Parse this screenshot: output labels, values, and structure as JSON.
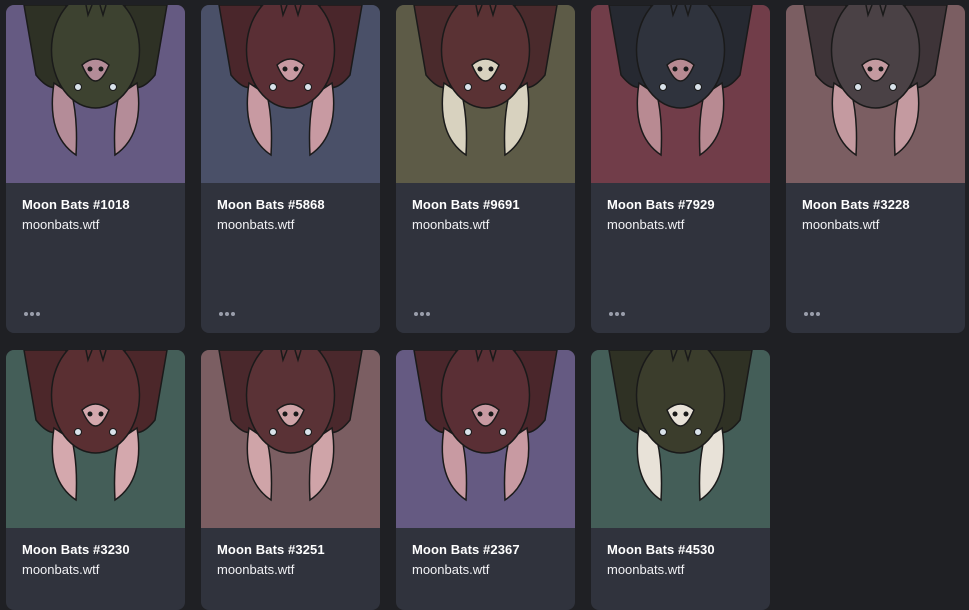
{
  "cards": [
    {
      "name": "Moon Bats #1018",
      "collection": "moonbats.wtf",
      "bg": "#655a82",
      "bat": "#3d4230",
      "wing": "#2e3125",
      "accent": "#b48c98",
      "icon": "bat-nft-image",
      "show_more": true
    },
    {
      "name": "Moon Bats #5868",
      "collection": "moonbats.wtf",
      "bg": "#4a5068",
      "bat": "#5a2f35",
      "wing": "#4a262b",
      "accent": "#c89aa2",
      "icon": "bat-nft-image",
      "show_more": true
    },
    {
      "name": "Moon Bats #9691",
      "collection": "moonbats.wtf",
      "bg": "#5d5b47",
      "bat": "#5a3234",
      "wing": "#4a2a2c",
      "accent": "#d8d2bf",
      "icon": "bat-nft-image",
      "show_more": true
    },
    {
      "name": "Moon Bats #7929",
      "collection": "moonbats.wtf",
      "bg": "#713d49",
      "bat": "#2f333d",
      "wing": "#262931",
      "accent": "#b88a92",
      "icon": "bat-nft-image",
      "show_more": true
    },
    {
      "name": "Moon Bats #3228",
      "collection": "moonbats.wtf",
      "bg": "#7b5e62",
      "bat": "#4a4145",
      "wing": "#3e3438",
      "accent": "#c49aa0",
      "icon": "bat-nft-image",
      "show_more": true
    },
    {
      "name": "Moon Bats #3230",
      "collection": "moonbats.wtf",
      "bg": "#445e58",
      "bat": "#5a2f32",
      "wing": "#4c272a",
      "accent": "#d4a8ad",
      "icon": "bat-nft-image",
      "show_more": false
    },
    {
      "name": "Moon Bats #3251",
      "collection": "moonbats.wtf",
      "bg": "#7b5e62",
      "bat": "#5a3236",
      "wing": "#4a282c",
      "accent": "#cfa4a8",
      "icon": "bat-nft-image",
      "show_more": false
    },
    {
      "name": "Moon Bats #2367",
      "collection": "moonbats.wtf",
      "bg": "#655a82",
      "bat": "#5a2f35",
      "wing": "#4a262b",
      "accent": "#c89aa2",
      "icon": "bat-nft-image",
      "show_more": false
    },
    {
      "name": "Moon Bats #4530",
      "collection": "moonbats.wtf",
      "bg": "#445e58",
      "bat": "#3b3d2c",
      "wing": "#2f3124",
      "accent": "#e8e2d8",
      "icon": "bat-nft-image",
      "show_more": false
    }
  ]
}
